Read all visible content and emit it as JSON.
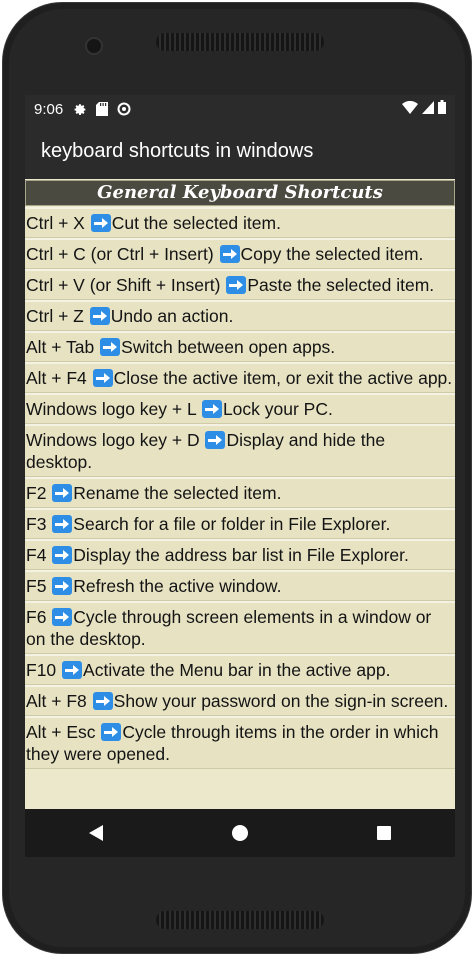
{
  "status": {
    "time": "9:06",
    "icons": [
      "gear-icon",
      "sd-card-icon",
      "sync-icon"
    ],
    "right_icons": [
      "wifi-icon",
      "signal-icon",
      "battery-icon"
    ]
  },
  "app": {
    "title": "keyboard shortcuts in windows"
  },
  "section": {
    "header": "General Keyboard Shortcuts"
  },
  "shortcuts": [
    {
      "key": "Ctrl + X ",
      "desc": "Cut the selected item."
    },
    {
      "key": "Ctrl + C (or Ctrl + Insert) ",
      "desc": "Copy the selected item."
    },
    {
      "key": "Ctrl + V (or Shift + Insert) ",
      "desc": "Paste the selected item."
    },
    {
      "key": "Ctrl + Z ",
      "desc": "Undo an action."
    },
    {
      "key": "Alt + Tab ",
      "desc": "Switch between open apps."
    },
    {
      "key": "Alt + F4 ",
      "desc": "Close the active item, or exit the active app."
    },
    {
      "key": "Windows logo key  + L ",
      "desc": "Lock your PC."
    },
    {
      "key": "Windows logo key  + D ",
      "desc": "Display and hide the desktop."
    },
    {
      "key": "F2 ",
      "desc": "Rename the selected item."
    },
    {
      "key": "F3 ",
      "desc": "Search for a file or folder in File Explorer."
    },
    {
      "key": "F4 ",
      "desc": "Display the address bar list in File Explorer."
    },
    {
      "key": "F5 ",
      "desc": "Refresh the active window."
    },
    {
      "key": "F6 ",
      "desc": "Cycle through screen elements in a window or on the desktop."
    },
    {
      "key": "F10 ",
      "desc": "Activate the Menu bar in the active app."
    },
    {
      "key": "Alt + F8 ",
      "desc": "Show your password on the sign-in screen."
    },
    {
      "key": "Alt + Esc ",
      "desc": "Cycle through items in the order in which they were opened."
    }
  ],
  "nav": {
    "icons": [
      "back-icon",
      "home-icon",
      "recents-icon"
    ]
  }
}
